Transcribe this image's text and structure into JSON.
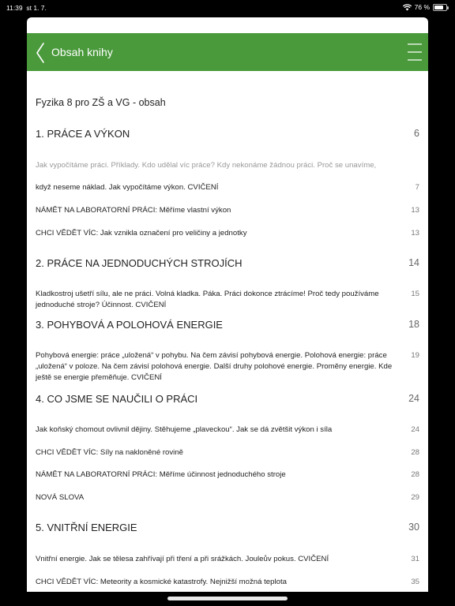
{
  "status": {
    "time": "11:39",
    "date": "st 1. 7.",
    "battery": "76 %",
    "battery_level": 0.76
  },
  "header": {
    "title": "Obsah knihy"
  },
  "book_title": "Fyzika 8 pro ZŠ a VG - obsah",
  "chapters": [
    {
      "title": "1. PRÁCE A VÝKON",
      "page": "6"
    },
    {
      "title": "2. PRÁCE NA JEDNODUCHÝCH STROJÍCH",
      "page": "14"
    },
    {
      "title": "3. POHYBOVÁ A POLOHOVÁ ENERGIE",
      "page": "18"
    },
    {
      "title": "4. CO JSME SE NAUČILI O PRÁCI",
      "page": "24"
    },
    {
      "title": "5. VNITŘNÍ ENERGIE",
      "page": "30"
    }
  ],
  "entries": [
    {
      "text": "Jak vypočítáme práci. Příklady. Kdo udělal víc práce? Kdy nekonáme žádnou práci. Proč se unavíme,",
      "page": ""
    },
    {
      "text": "když neseme náklad. Jak vypočítáme výkon. CVIČENÍ",
      "page": "7"
    },
    {
      "text": "NÁMĚT NA LABORATORNÍ PRÁCI: Měříme vlastní výkon",
      "page": "13"
    },
    {
      "text": "CHCI VĚDĚT VÍC: Jak vznikla označení pro veličiny a jednotky",
      "page": "13"
    },
    {
      "text": "Kladkostroj ušetří sílu, ale ne práci. Volná kladka. Páka. Práci dokonce ztrácíme! Proč tedy používáme jednoduché stroje? Účinnost. CVIČENÍ",
      "page": "15"
    },
    {
      "text": "Pohybová energie: práce „uložená“ v pohybu. Na čem závisí pohybová energie. Polohová energie: práce „uložená“ v poloze. Na čem závisí polohová energie. Další druhy polohové energie. Proměny energie. Kde ještě se energie přeměňuje. CVIČENÍ",
      "page": "19"
    },
    {
      "text": "Jak koňský chomout ovlivnil dějiny. Stěhujeme „plaveckou“. Jak se dá zvětšit výkon i síla",
      "page": "24"
    },
    {
      "text": "CHCI VĚDĚT VÍC: Síly na nakloněné rovině",
      "page": "28"
    },
    {
      "text": "NÁMĚT NA LABORATORNÍ PRÁCI: Měříme účinnost jednoduchého stroje",
      "page": "28"
    },
    {
      "text": "NOVÁ SLOVA",
      "page": "29"
    },
    {
      "text": "Vnitřní energie. Jak se tělesa zahřívají při tření a při srážkách. Jouleův pokus. CVIČENÍ",
      "page": "31"
    },
    {
      "text": "CHCI VĚDĚT VÍC: Meteority a kosmické katastrofy. Nejnižší možná teplota",
      "page": "35"
    }
  ],
  "colors": {
    "accent": "#4a9a3c"
  },
  "icons": {
    "back": "chevron-left-icon",
    "menu": "hamburger-menu-icon",
    "wifi": "wifi-icon",
    "battery": "battery-icon"
  }
}
